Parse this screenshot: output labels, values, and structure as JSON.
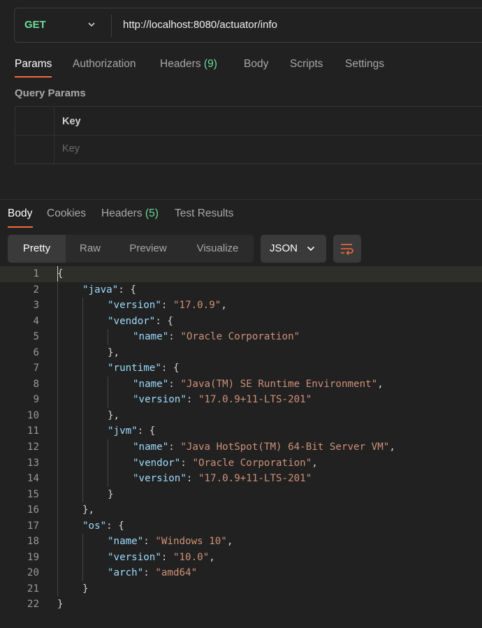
{
  "request": {
    "method": "GET",
    "url": "http://localhost:8080/actuator/info"
  },
  "request_tabs": [
    {
      "label": "Params",
      "count": ""
    },
    {
      "label": "Authorization",
      "count": ""
    },
    {
      "label": "Headers",
      "count": "(9)"
    },
    {
      "label": "Body",
      "count": ""
    },
    {
      "label": "Scripts",
      "count": ""
    },
    {
      "label": "Settings",
      "count": ""
    }
  ],
  "query_params": {
    "title": "Query Params",
    "key_header": "Key",
    "key_placeholder": "Key"
  },
  "response_tabs": [
    {
      "label": "Body",
      "count": ""
    },
    {
      "label": "Cookies",
      "count": ""
    },
    {
      "label": "Headers",
      "count": "(5)"
    },
    {
      "label": "Test Results",
      "count": ""
    }
  ],
  "view_modes": [
    "Pretty",
    "Raw",
    "Preview",
    "Visualize"
  ],
  "format": "JSON",
  "icons": {
    "method_dropdown": "chevron-down-icon",
    "format_dropdown": "chevron-down-icon",
    "wrap": "wrap-lines-icon"
  },
  "colors": {
    "accent": "#f26b3a",
    "method": "#6bdd9a",
    "key": "#9cdcfe",
    "string": "#ce9178"
  },
  "code_lines": [
    {
      "n": "1",
      "indent": 0,
      "key": "",
      "value": "",
      "punct": "{"
    },
    {
      "n": "2",
      "indent": 1,
      "key": "\"java\"",
      "value": "",
      "punct": ": {"
    },
    {
      "n": "3",
      "indent": 2,
      "key": "\"version\"",
      "value": "\"17.0.9\"",
      "punct": ","
    },
    {
      "n": "4",
      "indent": 2,
      "key": "\"vendor\"",
      "value": "",
      "punct": ": {"
    },
    {
      "n": "5",
      "indent": 3,
      "key": "\"name\"",
      "value": "\"Oracle Corporation\"",
      "punct": ""
    },
    {
      "n": "6",
      "indent": 2,
      "key": "",
      "value": "",
      "punct": "},"
    },
    {
      "n": "7",
      "indent": 2,
      "key": "\"runtime\"",
      "value": "",
      "punct": ": {"
    },
    {
      "n": "8",
      "indent": 3,
      "key": "\"name\"",
      "value": "\"Java(TM) SE Runtime Environment\"",
      "punct": ","
    },
    {
      "n": "9",
      "indent": 3,
      "key": "\"version\"",
      "value": "\"17.0.9+11-LTS-201\"",
      "punct": ""
    },
    {
      "n": "10",
      "indent": 2,
      "key": "",
      "value": "",
      "punct": "},"
    },
    {
      "n": "11",
      "indent": 2,
      "key": "\"jvm\"",
      "value": "",
      "punct": ": {"
    },
    {
      "n": "12",
      "indent": 3,
      "key": "\"name\"",
      "value": "\"Java HotSpot(TM) 64-Bit Server VM\"",
      "punct": ","
    },
    {
      "n": "13",
      "indent": 3,
      "key": "\"vendor\"",
      "value": "\"Oracle Corporation\"",
      "punct": ","
    },
    {
      "n": "14",
      "indent": 3,
      "key": "\"version\"",
      "value": "\"17.0.9+11-LTS-201\"",
      "punct": ""
    },
    {
      "n": "15",
      "indent": 2,
      "key": "",
      "value": "",
      "punct": "}"
    },
    {
      "n": "16",
      "indent": 1,
      "key": "",
      "value": "",
      "punct": "},"
    },
    {
      "n": "17",
      "indent": 1,
      "key": "\"os\"",
      "value": "",
      "punct": ": {"
    },
    {
      "n": "18",
      "indent": 2,
      "key": "\"name\"",
      "value": "\"Windows 10\"",
      "punct": ","
    },
    {
      "n": "19",
      "indent": 2,
      "key": "\"version\"",
      "value": "\"10.0\"",
      "punct": ","
    },
    {
      "n": "20",
      "indent": 2,
      "key": "\"arch\"",
      "value": "\"amd64\"",
      "punct": ""
    },
    {
      "n": "21",
      "indent": 1,
      "key": "",
      "value": "",
      "punct": "}"
    },
    {
      "n": "22",
      "indent": 0,
      "key": "",
      "value": "",
      "punct": "}"
    }
  ]
}
